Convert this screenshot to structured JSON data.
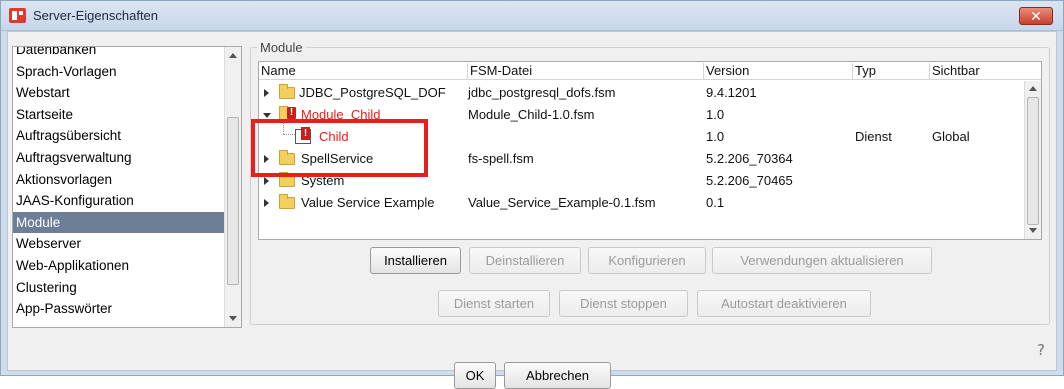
{
  "window": {
    "title": "Server-Eigenschaften",
    "close_glyph": "✕"
  },
  "sidebar": {
    "items": [
      {
        "label": "Datenbanken",
        "selected": false
      },
      {
        "label": "Sprach-Vorlagen",
        "selected": false
      },
      {
        "label": "Webstart",
        "selected": false
      },
      {
        "label": "Startseite",
        "selected": false
      },
      {
        "label": "Auftragsübersicht",
        "selected": false
      },
      {
        "label": "Auftragsverwaltung",
        "selected": false
      },
      {
        "label": "Aktionsvorlagen",
        "selected": false
      },
      {
        "label": "JAAS-Konfiguration",
        "selected": false
      },
      {
        "label": "Module",
        "selected": true
      },
      {
        "label": "Webserver",
        "selected": false
      },
      {
        "label": "Web-Applikationen",
        "selected": false
      },
      {
        "label": "Clustering",
        "selected": false
      },
      {
        "label": "App-Passwörter",
        "selected": false
      }
    ]
  },
  "modules": {
    "group_label": "Module",
    "columns": [
      "Name",
      "FSM-Datei",
      "Version",
      "Typ",
      "Sichtbar"
    ],
    "rows": [
      {
        "name": "JDBC_PostgreSQL_DOF",
        "file": "jdbc_postgresql_dofs.fsm",
        "version": "9.4.1201",
        "type": "",
        "visible": "",
        "icon": "folder-icon"
      },
      {
        "name": "Module_Child",
        "file": "Module_Child-1.0.fsm",
        "version": "1.0",
        "type": "",
        "visible": "",
        "icon": "folder-warning-icon"
      },
      {
        "name": "Child",
        "file": "",
        "version": "1.0",
        "type": "Dienst",
        "visible": "Global",
        "icon": "component-warning-icon"
      },
      {
        "name": "SpellService",
        "file": "fs-spell.fsm",
        "version": "5.2.206_70364",
        "type": "",
        "visible": "",
        "icon": "folder-icon"
      },
      {
        "name": "System",
        "file": "",
        "version": "5.2.206_70465",
        "type": "",
        "visible": "",
        "icon": "folder-icon"
      },
      {
        "name": "Value Service Example",
        "file": "Value_Service_Example-0.1.fsm",
        "version": "0.1",
        "type": "",
        "visible": "",
        "icon": "folder-icon"
      }
    ]
  },
  "buttons": {
    "install": "Installieren",
    "uninstall": "Deinstallieren",
    "configure": "Konfigurieren",
    "update_usages": "Verwendungen aktualisieren",
    "start_service": "Dienst starten",
    "stop_service": "Dienst stoppen",
    "autostart": "Autostart deaktivieren",
    "ok": "OK",
    "cancel": "Abbrechen",
    "help": "?"
  },
  "colors": {
    "highlight": "#e8201c",
    "selection": "#6c7f96",
    "warning_text": "#e8201c"
  }
}
